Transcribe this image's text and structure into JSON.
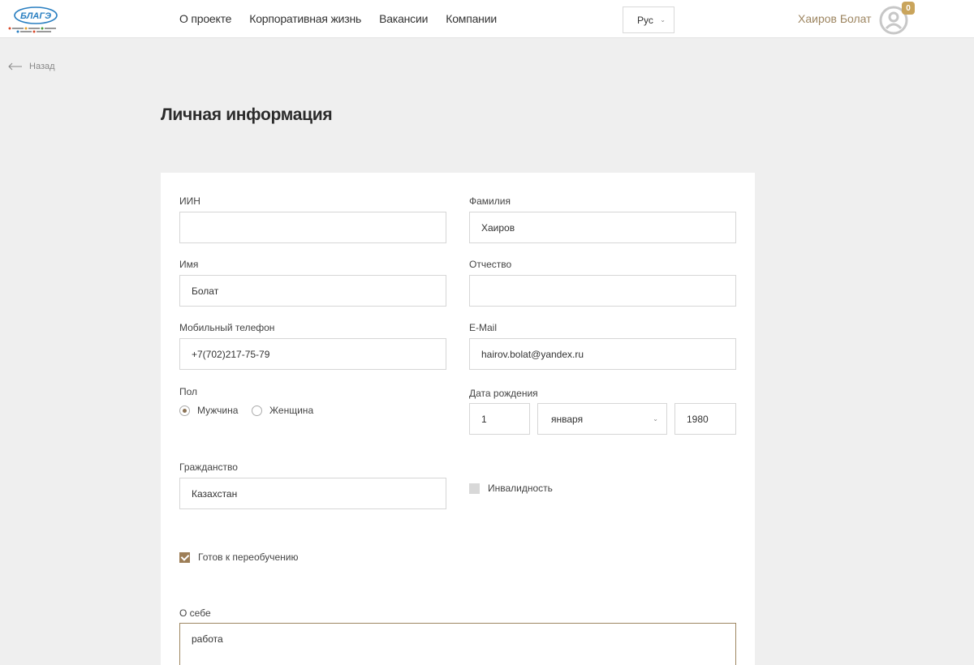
{
  "header": {
    "logo_text": "БЛАГЭ",
    "nav": [
      "О проекте",
      "Корпоративная жизнь",
      "Вакансии",
      "Компании"
    ],
    "language": "Рус",
    "username": "Хаиров Болат",
    "notifications_count": "0"
  },
  "back_label": "Назад",
  "page_title": "Личная информация",
  "form": {
    "iin": {
      "label": "ИИН",
      "value": ""
    },
    "surname": {
      "label": "Фамилия",
      "value": "Хаиров"
    },
    "name": {
      "label": "Имя",
      "value": "Болат"
    },
    "patronymic": {
      "label": "Отчество",
      "value": ""
    },
    "phone": {
      "label": "Мобильный телефон",
      "value": "+7(702)217-75-79"
    },
    "email": {
      "label": "E-Mail",
      "value": "hairov.bolat@yandex.ru"
    },
    "gender": {
      "label": "Пол",
      "options": [
        "Мужчина",
        "Женщина"
      ],
      "selected": "Мужчина"
    },
    "birthdate": {
      "label": "Дата рождения",
      "day": "1",
      "month": "января",
      "year": "1980"
    },
    "citizenship": {
      "label": "Гражданство",
      "value": "Казахстан"
    },
    "disability": {
      "label": "Инвалидность",
      "checked": false
    },
    "retraining": {
      "label": "Готов к переобучению",
      "checked": true
    },
    "about": {
      "label": "О себе",
      "value": "работа"
    }
  },
  "colors": {
    "accent": "#9d8560",
    "badge": "#c9a45b",
    "background": "#efefef"
  }
}
